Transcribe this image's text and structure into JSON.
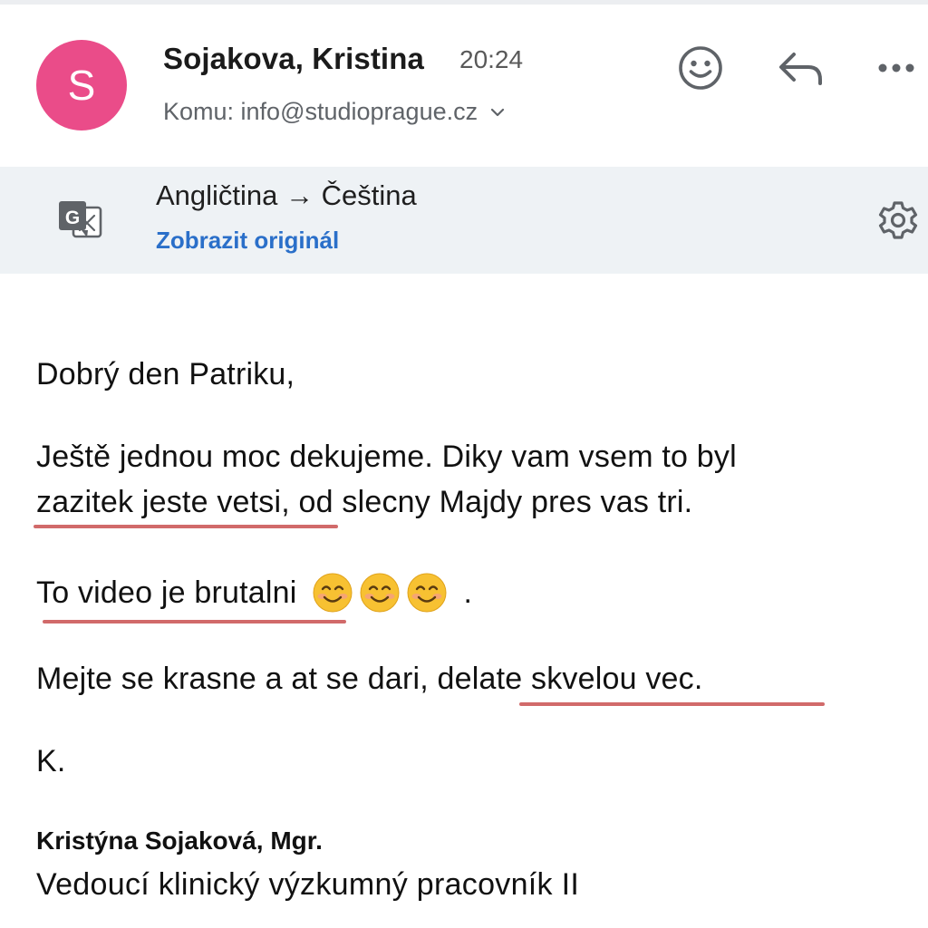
{
  "colors": {
    "avatar_bg": "#ea4c89",
    "link": "#2a6fc9",
    "spellcheck_underline": "#d16a6a",
    "translate_bar_bg": "#eef2f5"
  },
  "header": {
    "avatar_initial": "S",
    "sender_name": "Sojakova, Kristina",
    "time": "20:24",
    "recipient_label": "Komu: info@studioprague.cz",
    "actions": {
      "emoji_icon": "smiley-icon",
      "reply_icon": "reply-icon",
      "more_icon": "more-dots-icon"
    }
  },
  "translation": {
    "icon": "translate-icon",
    "language_pair": "Angličtina → Čeština",
    "show_original": "Zobrazit originál",
    "settings_icon": "gear-icon"
  },
  "message": {
    "greeting": "Dobrý den Patriku,",
    "paragraph1_line1": "Ještě jednou moc dekujeme. Diky vam vsem to byl",
    "paragraph1_line2_flagged": "zazitek jeste vetsi,",
    "paragraph1_line2_rest": " od slecny Majdy pres vas tri.",
    "paragraph2_flagged": "To video je brutalni",
    "paragraph2_emojis": [
      "😊",
      "😊",
      "😊"
    ],
    "paragraph2_trailing": ".",
    "paragraph3_start": "Mejte se krasne a at se dari, ",
    "paragraph3_flagged": "delate skvelou vec.",
    "closing": "K."
  },
  "signature": {
    "name": "Kristýna Sojaková, Mgr.",
    "title": "Vedoucí klinický výzkumný pracovník II"
  }
}
